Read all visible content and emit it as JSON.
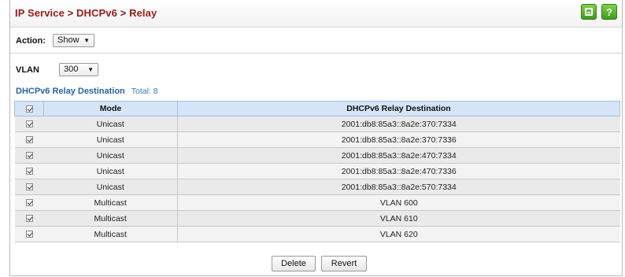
{
  "breadcrumb": {
    "part1": "IP Service",
    "sep1": " > ",
    "part2": "DHCPv6",
    "sep2": " > ",
    "part3": "Relay"
  },
  "header_icons": {
    "save": "save-icon",
    "help": "help-icon",
    "help_glyph": "?"
  },
  "action": {
    "label": "Action:",
    "value": "Show"
  },
  "vlan": {
    "label": "VLAN",
    "value": "300"
  },
  "section": {
    "title": "DHCPv6 Relay Destination",
    "total": "Total: 8"
  },
  "table": {
    "headers": {
      "mode": "Mode",
      "destination": "DHCPv6 Relay Destination"
    },
    "rows": [
      {
        "mode": "Unicast",
        "destination": "2001:db8:85a3::8a2e:370:7334"
      },
      {
        "mode": "Unicast",
        "destination": "2001:db8:85a3::8a2e:370:7336"
      },
      {
        "mode": "Unicast",
        "destination": "2001:db8:85a3::8a2e:470:7334"
      },
      {
        "mode": "Unicast",
        "destination": "2001:db8:85a3::8a2e:470:7336"
      },
      {
        "mode": "Unicast",
        "destination": "2001:db8:85a3::8a2e:570:7334"
      },
      {
        "mode": "Multicast",
        "destination": "VLAN 600"
      },
      {
        "mode": "Multicast",
        "destination": "VLAN 610"
      },
      {
        "mode": "Multicast",
        "destination": "VLAN 620"
      }
    ]
  },
  "buttons": {
    "delete": "Delete",
    "revert": "Revert"
  },
  "colors": {
    "title": "#9a1b1b",
    "accent": "#2a62a8",
    "header_bg": "#d5e5f7",
    "icon_green": "#4caf20"
  }
}
